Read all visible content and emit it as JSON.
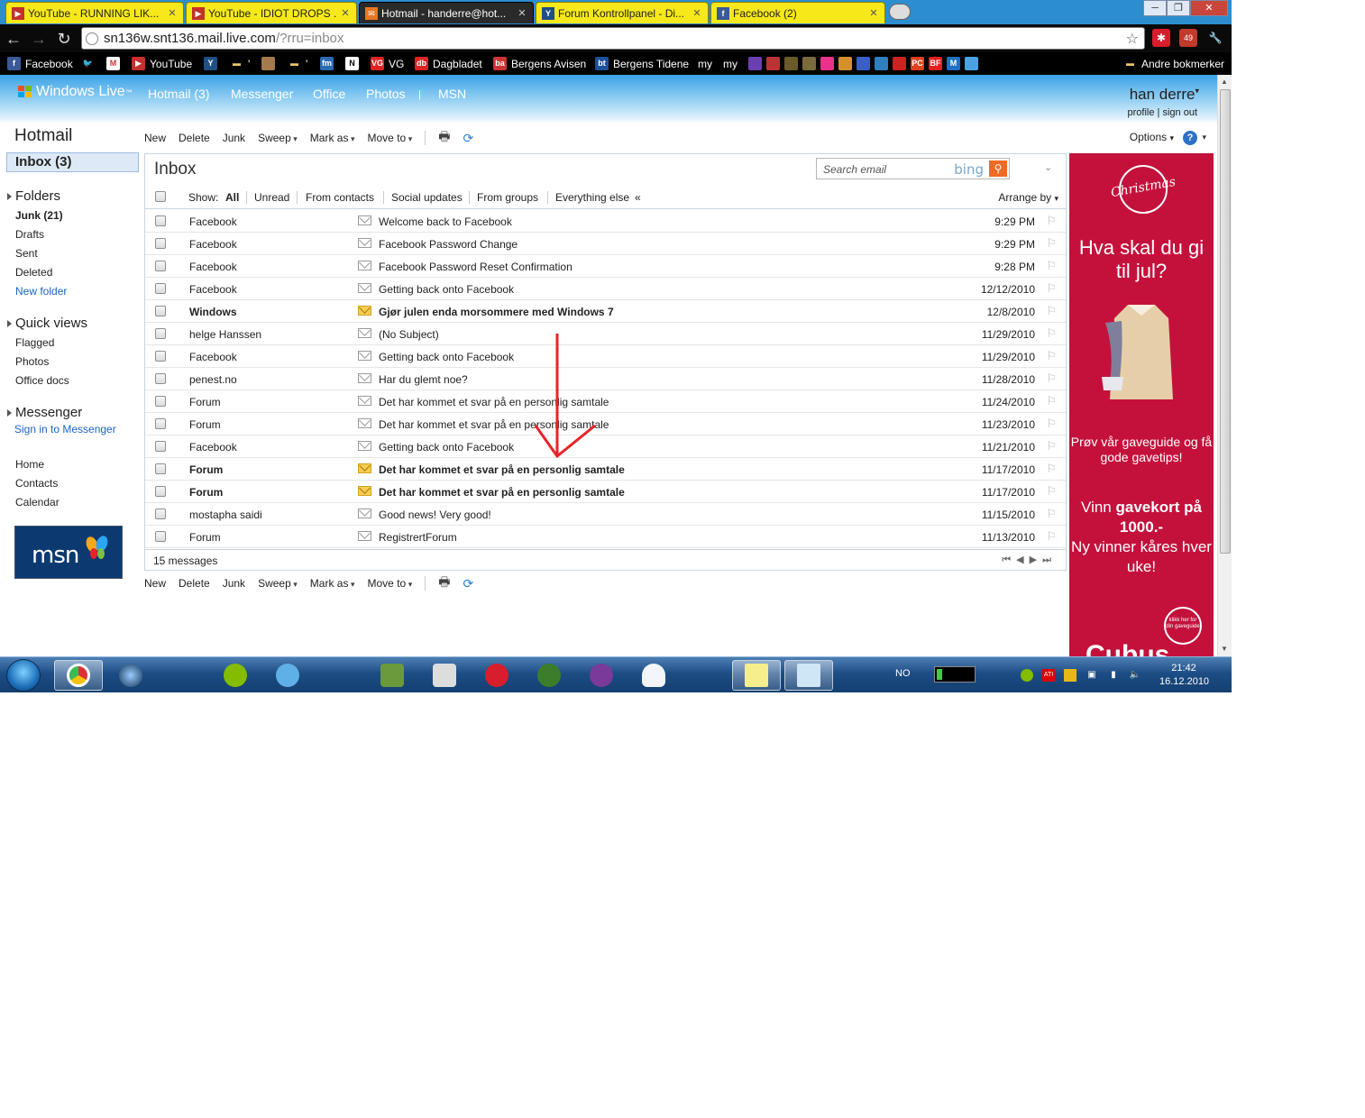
{
  "browser": {
    "tabs": [
      {
        "label": "YouTube - RUNNING LIK...",
        "icon": "youtube-icon",
        "active": false
      },
      {
        "label": "YouTube - IDIOT DROPS ...",
        "icon": "youtube-icon",
        "active": false
      },
      {
        "label": "Hotmail - handerre@hot...",
        "icon": "hotmail-icon",
        "active": true
      },
      {
        "label": "Forum Kontrollpanel - Di...",
        "icon": "forum-icon",
        "active": false
      },
      {
        "label": "Facebook (2)",
        "icon": "facebook-icon",
        "active": false
      }
    ],
    "address": {
      "host": "sn136w.snt136.mail.live.com",
      "path": "/?rru=inbox"
    },
    "extension_badge": "49",
    "bookmarks": [
      {
        "label": "Facebook",
        "icon": "facebook-icon"
      },
      {
        "label": "",
        "icon": "twitter-icon"
      },
      {
        "label": "",
        "icon": "gmail-icon"
      },
      {
        "label": "YouTube",
        "icon": "youtube-icon"
      },
      {
        "label": "",
        "icon": "forum-icon"
      },
      {
        "label": "'",
        "icon": "folder-icon"
      },
      {
        "label": "",
        "icon": "image-icon"
      },
      {
        "label": "'",
        "icon": "folder-icon"
      },
      {
        "label": "",
        "icon": "fm-icon"
      },
      {
        "label": "",
        "icon": "n-icon"
      },
      {
        "label": "VG",
        "icon": "vg-icon"
      },
      {
        "label": "Dagbladet",
        "icon": "db-icon"
      },
      {
        "label": "Bergens Avisen",
        "icon": "ba-icon"
      },
      {
        "label": "Bergens Tidene",
        "icon": "bt-icon"
      },
      {
        "label": "my",
        "icon": ""
      },
      {
        "label": "my",
        "icon": ""
      }
    ],
    "other_bookmarks": "Andre bokmerker"
  },
  "header": {
    "brand": "Windows Live",
    "brand_tm": "™",
    "nav": [
      "Hotmail (3)",
      "Messenger",
      "Office",
      "Photos",
      "|",
      "MSN"
    ],
    "user_name": "han derre",
    "profile_link": "profile",
    "sign_out_link": "sign out",
    "link_sep": "|"
  },
  "sidebar": {
    "title": "Hotmail",
    "inbox": "Inbox (3)",
    "folders_head": "Folders",
    "folders": [
      {
        "label": "Junk (21)",
        "bold": true
      },
      {
        "label": "Drafts"
      },
      {
        "label": "Sent"
      },
      {
        "label": "Deleted"
      },
      {
        "label": "New folder",
        "link": true
      }
    ],
    "quick_head": "Quick views",
    "quick": [
      "Flagged",
      "Photos",
      "Office docs"
    ],
    "messenger_head": "Messenger",
    "messenger_link": "Sign in to Messenger",
    "bottom": [
      "Home",
      "Contacts",
      "Calendar"
    ],
    "msn_logo": "msn"
  },
  "toolbar": {
    "new": "New",
    "delete": "Delete",
    "junk": "Junk",
    "sweep": "Sweep",
    "mark_as": "Mark as",
    "move_to": "Move to",
    "options": "Options"
  },
  "inbox": {
    "title": "Inbox",
    "search_placeholder": "Search email",
    "search_brand": "bing",
    "show_label": "Show:",
    "filters": [
      "All",
      "Unread",
      "From contacts",
      "Social updates",
      "From groups",
      "Everything else"
    ],
    "filter_collapse": "«",
    "arrange_by": "Arrange by",
    "messages": [
      {
        "from": "Facebook",
        "subject": "Welcome back to Facebook",
        "date": "9:29 PM",
        "unread": false
      },
      {
        "from": "Facebook",
        "subject": "Facebook Password Change",
        "date": "9:29 PM",
        "unread": false
      },
      {
        "from": "Facebook",
        "subject": "Facebook Password Reset Confirmation",
        "date": "9:28 PM",
        "unread": false
      },
      {
        "from": "Facebook",
        "subject": "Getting back onto Facebook",
        "date": "12/12/2010",
        "unread": false
      },
      {
        "from": "Windows",
        "subject": "Gjør julen enda morsommere med Windows 7",
        "date": "12/8/2010",
        "unread": true
      },
      {
        "from": "helge Hanssen",
        "subject": "(No Subject)",
        "date": "11/29/2010",
        "unread": false
      },
      {
        "from": "Facebook",
        "subject": "Getting back onto Facebook",
        "date": "11/29/2010",
        "unread": false
      },
      {
        "from": "penest.no",
        "subject": "Har du glemt noe?",
        "date": "11/28/2010",
        "unread": false
      },
      {
        "from": "Forum",
        "subject": "Det har kommet et svar på en personlig samtale",
        "date": "11/24/2010",
        "unread": false
      },
      {
        "from": "Forum",
        "subject": "Det har kommet et svar på en personlig samtale",
        "date": "11/23/2010",
        "unread": false
      },
      {
        "from": "Facebook",
        "subject": "Getting back onto Facebook",
        "date": "11/21/2010",
        "unread": false
      },
      {
        "from": "Forum",
        "subject": "Det har kommet et svar på en personlig samtale",
        "date": "11/17/2010",
        "unread": true
      },
      {
        "from": "Forum",
        "subject": "Det har kommet et svar på en personlig samtale",
        "date": "11/17/2010",
        "unread": true
      },
      {
        "from": "mostapha saidi",
        "subject": "Good news! Very good!",
        "date": "11/15/2010",
        "unread": false
      },
      {
        "from": "Forum",
        "subject": "RegistrertForum",
        "date": "11/13/2010",
        "unread": false
      }
    ],
    "message_count": "15 messages"
  },
  "ad": {
    "badge_text": "Christmas",
    "headline": "Hva skal du gi til jul?",
    "subline": "Prøv vår gaveguide og få gode gavetips!",
    "win_line1": "Vinn ",
    "win_bold": "gavekort på 1000.-",
    "win_line2": "Ny vinner kåres hver uke!",
    "stamp": "klikk her for din gaveguide",
    "logo": "Cubus",
    "bg_color": "#c4113c"
  },
  "taskbar": {
    "language": "NO",
    "time": "21:42",
    "date": "16.12.2010"
  },
  "annotation": {
    "color": "#e8232a"
  }
}
